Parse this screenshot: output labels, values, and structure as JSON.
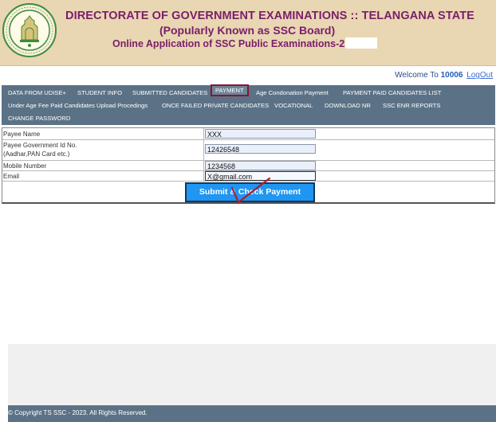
{
  "header": {
    "title": "DIRECTORATE OF GOVERNMENT EXAMINATIONS :: TELANGANA STATE",
    "subtitle": "(Popularly Known as SSC Board)",
    "application_title": "Online Application of SSC Public Examinations-2"
  },
  "user": {
    "welcome_label": "Welcome To",
    "id": "10006",
    "logout_label": "LogOut"
  },
  "nav": {
    "row1": [
      "DATA FROM UDISE+",
      "STUDENT INFO",
      "SUBMITTED CANDIDATES",
      "PAYMENT",
      "Age Condonation Payment",
      "PAYMENT PAID CANDIDATES LIST"
    ],
    "row2": [
      "Under Age Fee Paid Candidates Upload Procedings",
      "ONCE FAILED PRIVATE CANDIDATES",
      "VOCATIONAL",
      "DOWNLOAD NR",
      "SSC ENR REPORTS"
    ],
    "row3": [
      "CHANGE PASSWORD"
    ],
    "active": "PAYMENT"
  },
  "form": {
    "payee_name": {
      "label": "Payee Name",
      "value": "XXX"
    },
    "payee_gov_id": {
      "label_line1": "Payee Government Id No.",
      "label_line2": "(Aadhar,PAN Card etc.)",
      "value": "12426548"
    },
    "mobile": {
      "label": "Mobile Number",
      "value": "1234568"
    },
    "email": {
      "label": "Email",
      "value": "X@gmail.com"
    },
    "submit_label": "Submit & Check Payment"
  },
  "footer": {
    "copyright": "© Copyright TS SSC - 2023. All Rights Reserved."
  },
  "colors": {
    "header_bg": "#e9d6b2",
    "title_text": "#7a1e6a",
    "nav_bg": "#5b7286",
    "submit_bg": "#1f96f2",
    "active_border": "#8a1430",
    "check_mark": "#b01c2e"
  }
}
